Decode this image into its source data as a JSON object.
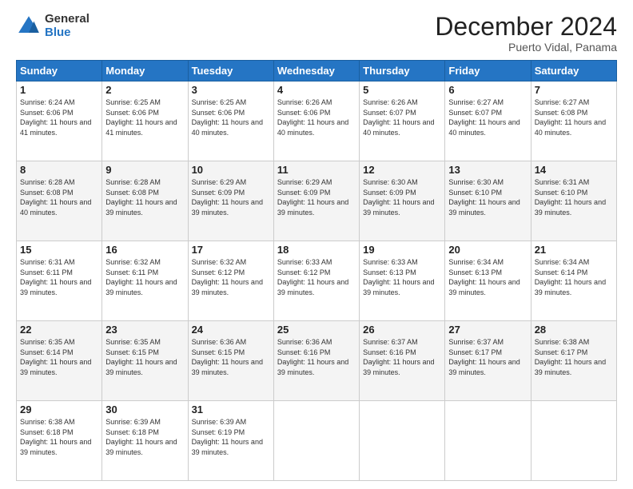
{
  "header": {
    "logo_general": "General",
    "logo_blue": "Blue",
    "title": "December 2024",
    "subtitle": "Puerto Vidal, Panama"
  },
  "days_of_week": [
    "Sunday",
    "Monday",
    "Tuesday",
    "Wednesday",
    "Thursday",
    "Friday",
    "Saturday"
  ],
  "weeks": [
    [
      {
        "day": 1,
        "sunrise": "6:24 AM",
        "sunset": "6:06 PM",
        "daylight": "11 hours and 41 minutes."
      },
      {
        "day": 2,
        "sunrise": "6:25 AM",
        "sunset": "6:06 PM",
        "daylight": "11 hours and 41 minutes."
      },
      {
        "day": 3,
        "sunrise": "6:25 AM",
        "sunset": "6:06 PM",
        "daylight": "11 hours and 40 minutes."
      },
      {
        "day": 4,
        "sunrise": "6:26 AM",
        "sunset": "6:06 PM",
        "daylight": "11 hours and 40 minutes."
      },
      {
        "day": 5,
        "sunrise": "6:26 AM",
        "sunset": "6:07 PM",
        "daylight": "11 hours and 40 minutes."
      },
      {
        "day": 6,
        "sunrise": "6:27 AM",
        "sunset": "6:07 PM",
        "daylight": "11 hours and 40 minutes."
      },
      {
        "day": 7,
        "sunrise": "6:27 AM",
        "sunset": "6:08 PM",
        "daylight": "11 hours and 40 minutes."
      }
    ],
    [
      {
        "day": 8,
        "sunrise": "6:28 AM",
        "sunset": "6:08 PM",
        "daylight": "11 hours and 40 minutes."
      },
      {
        "day": 9,
        "sunrise": "6:28 AM",
        "sunset": "6:08 PM",
        "daylight": "11 hours and 39 minutes."
      },
      {
        "day": 10,
        "sunrise": "6:29 AM",
        "sunset": "6:09 PM",
        "daylight": "11 hours and 39 minutes."
      },
      {
        "day": 11,
        "sunrise": "6:29 AM",
        "sunset": "6:09 PM",
        "daylight": "11 hours and 39 minutes."
      },
      {
        "day": 12,
        "sunrise": "6:30 AM",
        "sunset": "6:09 PM",
        "daylight": "11 hours and 39 minutes."
      },
      {
        "day": 13,
        "sunrise": "6:30 AM",
        "sunset": "6:10 PM",
        "daylight": "11 hours and 39 minutes."
      },
      {
        "day": 14,
        "sunrise": "6:31 AM",
        "sunset": "6:10 PM",
        "daylight": "11 hours and 39 minutes."
      }
    ],
    [
      {
        "day": 15,
        "sunrise": "6:31 AM",
        "sunset": "6:11 PM",
        "daylight": "11 hours and 39 minutes."
      },
      {
        "day": 16,
        "sunrise": "6:32 AM",
        "sunset": "6:11 PM",
        "daylight": "11 hours and 39 minutes."
      },
      {
        "day": 17,
        "sunrise": "6:32 AM",
        "sunset": "6:12 PM",
        "daylight": "11 hours and 39 minutes."
      },
      {
        "day": 18,
        "sunrise": "6:33 AM",
        "sunset": "6:12 PM",
        "daylight": "11 hours and 39 minutes."
      },
      {
        "day": 19,
        "sunrise": "6:33 AM",
        "sunset": "6:13 PM",
        "daylight": "11 hours and 39 minutes."
      },
      {
        "day": 20,
        "sunrise": "6:34 AM",
        "sunset": "6:13 PM",
        "daylight": "11 hours and 39 minutes."
      },
      {
        "day": 21,
        "sunrise": "6:34 AM",
        "sunset": "6:14 PM",
        "daylight": "11 hours and 39 minutes."
      }
    ],
    [
      {
        "day": 22,
        "sunrise": "6:35 AM",
        "sunset": "6:14 PM",
        "daylight": "11 hours and 39 minutes."
      },
      {
        "day": 23,
        "sunrise": "6:35 AM",
        "sunset": "6:15 PM",
        "daylight": "11 hours and 39 minutes."
      },
      {
        "day": 24,
        "sunrise": "6:36 AM",
        "sunset": "6:15 PM",
        "daylight": "11 hours and 39 minutes."
      },
      {
        "day": 25,
        "sunrise": "6:36 AM",
        "sunset": "6:16 PM",
        "daylight": "11 hours and 39 minutes."
      },
      {
        "day": 26,
        "sunrise": "6:37 AM",
        "sunset": "6:16 PM",
        "daylight": "11 hours and 39 minutes."
      },
      {
        "day": 27,
        "sunrise": "6:37 AM",
        "sunset": "6:17 PM",
        "daylight": "11 hours and 39 minutes."
      },
      {
        "day": 28,
        "sunrise": "6:38 AM",
        "sunset": "6:17 PM",
        "daylight": "11 hours and 39 minutes."
      }
    ],
    [
      {
        "day": 29,
        "sunrise": "6:38 AM",
        "sunset": "6:18 PM",
        "daylight": "11 hours and 39 minutes."
      },
      {
        "day": 30,
        "sunrise": "6:39 AM",
        "sunset": "6:18 PM",
        "daylight": "11 hours and 39 minutes."
      },
      {
        "day": 31,
        "sunrise": "6:39 AM",
        "sunset": "6:19 PM",
        "daylight": "11 hours and 39 minutes."
      },
      null,
      null,
      null,
      null
    ]
  ]
}
